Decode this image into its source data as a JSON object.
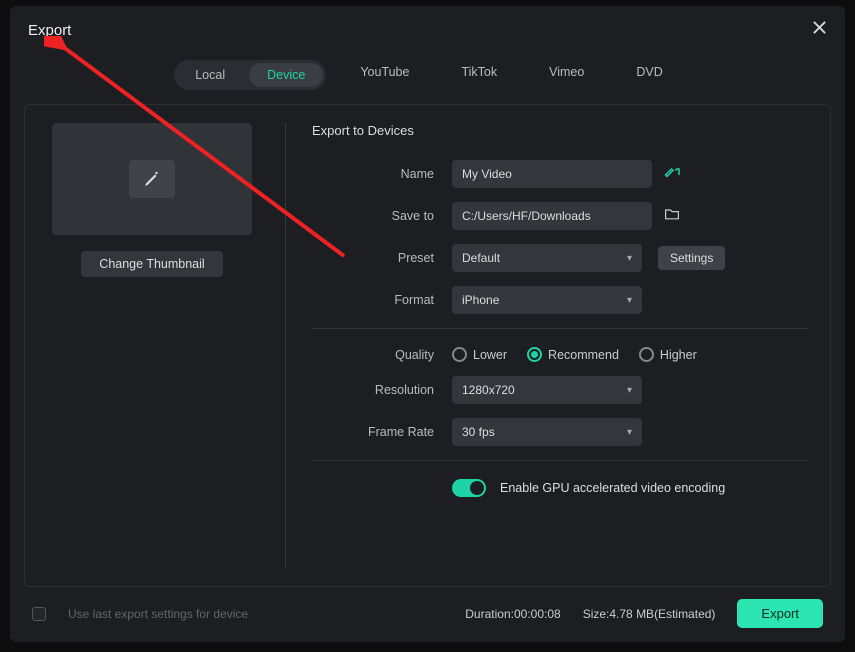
{
  "title": "Export",
  "tabs": [
    "Local",
    "Device",
    "YouTube",
    "TikTok",
    "Vimeo",
    "DVD"
  ],
  "active_tab_index": 1,
  "thumbnail_button": "Change Thumbnail",
  "section_title": "Export to Devices",
  "fields": {
    "name_label": "Name",
    "name_value": "My Video",
    "save_label": "Save to",
    "save_value": "C:/Users/HF/Downloads",
    "preset_label": "Preset",
    "preset_value": "Default",
    "settings_btn": "Settings",
    "format_label": "Format",
    "format_value": "iPhone",
    "quality_label": "Quality",
    "quality_options": [
      "Lower",
      "Recommend",
      "Higher"
    ],
    "quality_selected_index": 1,
    "resolution_label": "Resolution",
    "resolution_value": "1280x720",
    "framerate_label": "Frame Rate",
    "framerate_value": "30 fps",
    "gpu_label": "Enable GPU accelerated video encoding"
  },
  "footer": {
    "use_last": "Use last export settings for device",
    "duration_label": "Duration:",
    "duration_value": "00:00:08",
    "size_label": "Size:",
    "size_value": "4.78 MB(Estimated)",
    "export_btn": "Export"
  }
}
